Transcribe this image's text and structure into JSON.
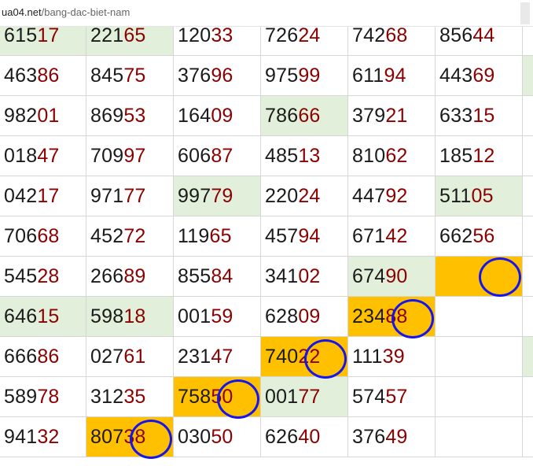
{
  "browser": {
    "url_host": "ua04.net",
    "url_path": "/bang-dac-biet-nam"
  },
  "colors": {
    "green_cell": "#e2efda",
    "orange_cell": "#ffc000",
    "circle": "#1515ee",
    "tail_digits": "#8b0000"
  },
  "table": {
    "rows": [
      [
        "61517",
        "22165",
        "12033",
        "72624",
        "74268",
        "85644"
      ],
      [
        "46386",
        "84575",
        "37696",
        "97599",
        "61194",
        "44369"
      ],
      [
        "98201",
        "86953",
        "16409",
        "78666",
        "37921",
        "63315"
      ],
      [
        "01847",
        "70997",
        "60687",
        "48513",
        "81062",
        "18512"
      ],
      [
        "04217",
        "97177",
        "99779",
        "22024",
        "44792",
        "51105"
      ],
      [
        "70668",
        "45272",
        "11965",
        "45794",
        "67142",
        "66256"
      ],
      [
        "54528",
        "26689",
        "85584",
        "34102",
        "67490",
        ""
      ],
      [
        "64615",
        "59818",
        "00159",
        "62809",
        "23488",
        ""
      ],
      [
        "66686",
        "02761",
        "23147",
        "74022",
        "11139",
        ""
      ],
      [
        "58978",
        "31235",
        "75850",
        "00177",
        "57457",
        ""
      ],
      [
        "94132",
        "80738",
        "03050",
        "62640",
        "37649",
        ""
      ]
    ],
    "highlights": [
      [
        "green",
        "green",
        "",
        "",
        "",
        ""
      ],
      [
        "",
        "",
        "",
        "",
        "",
        ""
      ],
      [
        "",
        "",
        "",
        "green",
        "",
        ""
      ],
      [
        "",
        "",
        "",
        "",
        "",
        ""
      ],
      [
        "",
        "",
        "green",
        "",
        "",
        "green"
      ],
      [
        "",
        "",
        "",
        "",
        "",
        ""
      ],
      [
        "",
        "",
        "",
        "",
        "green",
        "orange"
      ],
      [
        "green",
        "green",
        "",
        "",
        "orange",
        ""
      ],
      [
        "",
        "",
        "",
        "orange",
        "",
        ""
      ],
      [
        "",
        "",
        "orange",
        "green",
        "",
        ""
      ],
      [
        "",
        "orange",
        "",
        "",
        "",
        ""
      ]
    ],
    "circled_cells": [
      [
        6,
        5
      ],
      [
        7,
        4
      ],
      [
        8,
        3
      ],
      [
        9,
        2
      ],
      [
        10,
        1
      ]
    ],
    "edge_column_highlights": [
      "",
      "green",
      "",
      "",
      "",
      "",
      "",
      "",
      "green",
      "",
      ""
    ]
  }
}
